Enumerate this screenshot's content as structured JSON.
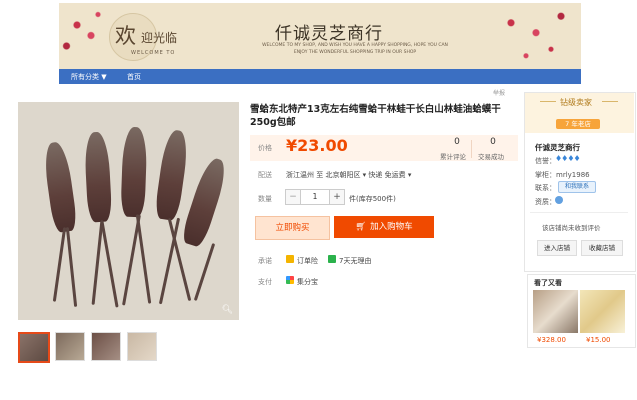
{
  "banner": {
    "welcome_big": "欢",
    "welcome_small": "迎光临",
    "welcome_en": "WELCOME TO",
    "shop_title": "仟诚灵芝商行",
    "tagline_en": "WELCOME TO MY SHOP, AND WISH YOU HAVE A HAPPY SHOPPING, HOPE YOU CAN ENJOY THE WONDERFUL SHOPPING TRIP IN OUR SHOP"
  },
  "nav": {
    "all_categories": "所有分类 ▼",
    "home": "首页"
  },
  "report_link": "举报",
  "product": {
    "title": "雪蛤东北特产13克左右纯雪蛤干林蛙干长白山林蛙油蛤蟆干250g包邮",
    "price_label": "价格",
    "price": "¥23.00",
    "review_count": "0",
    "review_label": "累计评论",
    "trade_count": "0",
    "trade_label": "交易成功",
    "ship_label": "配送",
    "ship_text": "浙江温州 至 北京朝阳区 ▾   快递 免运费 ▾",
    "qty_label": "数量",
    "qty_minus": "−",
    "qty_value": "1",
    "qty_plus": "+",
    "stock_text": "件(库存500件)",
    "buy_now": "立即购买",
    "add_to_cart": "加入购物车",
    "promise_label": "承诺",
    "order_text": "订单险",
    "return_text": "7天无理由",
    "pay_label": "支付",
    "pay_text": "集分宝"
  },
  "seller": {
    "diamond_title": "钻级卖家",
    "years_badge": "7 年老店",
    "shop_name": "仟诚灵芝商行",
    "credit_label": "信誉：",
    "credit_icons": "♦♦♦♦",
    "seller_label": "掌柜：mrly1986",
    "contact_label": "联系：",
    "wangwang": "和我联系",
    "qual_label": "资质：",
    "fav_text": "该店铺尚未收到评价",
    "enter_shop": "进入店铺",
    "fav_shop": "收藏店铺"
  },
  "also_viewed": {
    "title": "看了又看",
    "items": [
      {
        "price": "¥328.00"
      },
      {
        "price": "¥15.00"
      }
    ]
  },
  "colors": {
    "accent": "#f04a00",
    "nav": "#3b6fc2",
    "banner_bg": "#efe4cc"
  }
}
